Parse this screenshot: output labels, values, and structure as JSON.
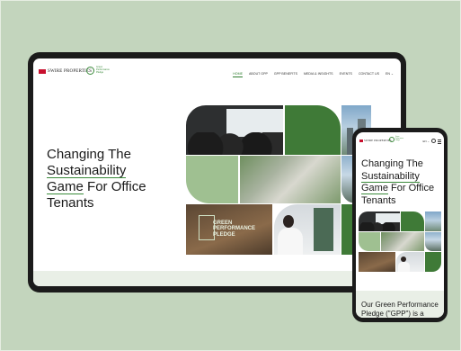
{
  "brand": {
    "company": "SWIRE PROPERTIES",
    "program_lines": [
      "Green",
      "Performance",
      "Pledge"
    ],
    "accent": "#3a8a3a",
    "logo_red": "#c8102e"
  },
  "nav": {
    "items": [
      "HOME",
      "ABOUT GPP",
      "GPP BENEFITS",
      "MEDIA & INSIGHTS",
      "EVENTS",
      "CONTACT US",
      "EN ⌄"
    ],
    "active_index": 0
  },
  "hero": {
    "line1": "Changing The",
    "line2": "Sustainability",
    "line3a": "Game",
    "line3b": " For Office",
    "line4": "Tenants",
    "pledge_art": [
      "GREEN",
      "PERFORMANCE",
      "PLEDGE"
    ]
  },
  "phone": {
    "lang": "EN ⌄",
    "headline1": "Changing The",
    "headline2": "Sustainability",
    "headline3a": "Game",
    "headline3b": " For Office",
    "headline4": "Tenants",
    "body": "Our Green Performance Pledge (\"GPP\") is a"
  }
}
